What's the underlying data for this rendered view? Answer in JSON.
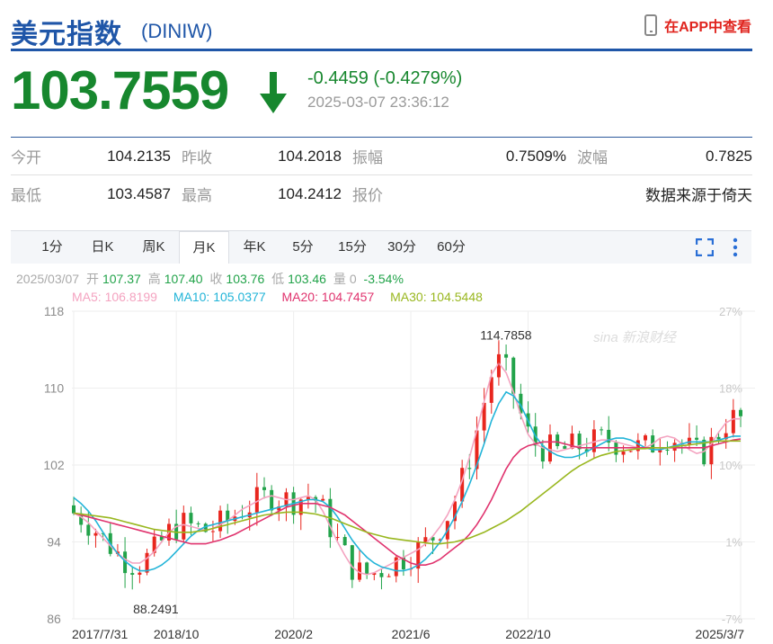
{
  "header": {
    "title": "美元指数",
    "code": "(DINIW)",
    "app_link": "在APP中查看"
  },
  "quote": {
    "price": "103.7559",
    "change": "-0.4459 (-0.4279%)",
    "timestamp": "2025-03-07 23:36:12",
    "down_color": "#17872e"
  },
  "stats": {
    "row1": [
      {
        "label": "今开",
        "value": "104.2135"
      },
      {
        "label": "昨收",
        "value": "104.2018"
      },
      {
        "label": "振幅",
        "value": "0.7509%"
      },
      {
        "label": "波幅",
        "value": "0.7825"
      }
    ],
    "row2": [
      {
        "label": "最低",
        "value": "103.4587"
      },
      {
        "label": "最高",
        "value": "104.2412"
      },
      {
        "label": "报价",
        "value": "数据来源于倚天"
      }
    ]
  },
  "tabs": [
    "1分",
    "日K",
    "周K",
    "月K",
    "年K",
    "5分",
    "15分",
    "30分",
    "60分"
  ],
  "active_tab": "月K",
  "ohlc_line": {
    "date": "2025/03/07",
    "open_label": "开",
    "open": "107.37",
    "high_label": "高",
    "high": "107.40",
    "close_label": "收",
    "close": "103.76",
    "low_label": "低",
    "low": "103.46",
    "vol_label": "量",
    "vol": "0",
    "pct": "-3.54%"
  },
  "ma_legend": [
    {
      "label": "MA5: 106.8199",
      "color": "#f4a3c0"
    },
    {
      "label": "MA10: 105.0377",
      "color": "#22b4d8"
    },
    {
      "label": "MA20: 104.7457",
      "color": "#e0336e"
    },
    {
      "label": "MA30: 104.5448",
      "color": "#99b71f"
    }
  ],
  "chart_data": {
    "type": "candlestick",
    "y_ticks": [
      "118",
      "110",
      "102",
      "94",
      "86"
    ],
    "y_tick_values": [
      118,
      110,
      102,
      94,
      86
    ],
    "ylim": [
      86,
      118
    ],
    "pct_ticks": [
      "27%",
      "18%",
      "10%",
      "1%",
      "-7%"
    ],
    "x_ticks": [
      "2017/7/31",
      "2018/10",
      "2020/2",
      "2021/6",
      "2022/10",
      "2025/3/7"
    ],
    "x_tick_months": [
      0,
      14,
      30,
      46,
      62,
      91
    ],
    "annotations": {
      "max": "114.7858",
      "min": "88.2491"
    },
    "watermark": "sina 新浪财经",
    "series": [
      {
        "name": "MA5",
        "color": "#f4a3c0",
        "values": [
          97,
          96.6,
          96,
          95.2,
          94.4,
          93.6,
          92.8,
          92.2,
          91.8,
          91.8,
          92.3,
          93.0,
          94.0,
          95.0,
          95.6,
          95.8,
          95.6,
          95.4,
          95.2,
          95.4,
          95.8,
          96.2,
          96.8,
          97.4,
          97.8,
          98.2,
          98.6,
          98.8,
          98.6,
          98.4,
          98.4,
          98.6,
          98.8,
          98.4,
          97.2,
          95.6,
          94.0,
          92.6,
          91.4,
          90.8,
          90.6,
          90.8,
          91.2,
          91.6,
          92.0,
          92.4,
          92.8,
          93.2,
          93.8,
          94.6,
          95.6,
          96.8,
          98.4,
          100.4,
          102.8,
          105.6,
          108.6,
          111.4,
          112.6,
          111.6,
          109.6,
          107.2,
          105.2,
          104.2,
          103.8,
          103.6,
          103.4,
          103.6,
          103.8,
          104.0,
          104.2,
          104.4,
          104.6,
          104.6,
          104.4,
          104.2,
          104.0,
          103.8,
          103.8,
          104.2,
          104.8,
          105.0,
          104.8,
          104.2,
          103.6,
          103.2,
          103.4,
          104.2,
          105.4,
          106.4,
          106.8,
          106.8
        ]
      },
      {
        "name": "MA10",
        "color": "#22b4d8",
        "values": [
          98.6,
          98.0,
          97.2,
          96.2,
          95.0,
          93.8,
          92.8,
          92.0,
          91.4,
          91.0,
          91.0,
          91.2,
          91.6,
          92.2,
          93.0,
          93.8,
          94.6,
          95.2,
          95.6,
          95.8,
          96.0,
          96.2,
          96.4,
          96.6,
          96.8,
          97.0,
          97.2,
          97.4,
          97.6,
          97.8,
          98.0,
          98.2,
          98.4,
          98.4,
          98.2,
          97.6,
          96.6,
          95.4,
          94.2,
          93.2,
          92.4,
          91.8,
          91.4,
          91.2,
          91.0,
          91.0,
          91.2,
          91.6,
          92.2,
          93.0,
          94.0,
          95.2,
          96.6,
          98.2,
          100.0,
          102.0,
          104.2,
          106.6,
          108.4,
          109.6,
          109.2,
          108.2,
          106.6,
          105.0,
          104.0,
          103.4,
          103.0,
          102.8,
          102.8,
          103.0,
          103.4,
          103.8,
          104.2,
          104.6,
          104.8,
          104.8,
          104.6,
          104.2,
          103.8,
          103.6,
          103.6,
          103.8,
          104.0,
          104.2,
          104.4,
          104.4,
          104.4,
          104.4,
          104.6,
          104.8,
          105.0,
          105.0
        ]
      },
      {
        "name": "MA20",
        "color": "#e0336e",
        "values": [
          97.0,
          96.8,
          96.6,
          96.4,
          96.2,
          96.0,
          95.8,
          95.6,
          95.4,
          95.2,
          95.0,
          94.8,
          94.6,
          94.4,
          94.2,
          94.0,
          93.8,
          93.8,
          93.8,
          94.0,
          94.2,
          94.5,
          94.8,
          95.2,
          95.6,
          96.0,
          96.4,
          96.8,
          97.2,
          97.6,
          97.8,
          98.0,
          98.0,
          98.0,
          97.8,
          97.6,
          97.2,
          96.8,
          96.2,
          95.6,
          95.0,
          94.4,
          93.8,
          93.2,
          92.6,
          92.2,
          91.8,
          91.6,
          91.6,
          91.8,
          92.2,
          92.8,
          93.4,
          94.0,
          94.8,
          95.8,
          97.0,
          98.4,
          100.0,
          101.6,
          102.8,
          103.6,
          104.0,
          104.2,
          104.4,
          104.4,
          104.4,
          104.2,
          104.0,
          103.8,
          103.8,
          103.8,
          103.8,
          103.8,
          103.8,
          103.8,
          103.8,
          103.8,
          103.8,
          103.8,
          103.8,
          103.8,
          103.8,
          103.8,
          103.8,
          103.8,
          103.8,
          104.0,
          104.2,
          104.4,
          104.6,
          104.7
        ]
      },
      {
        "name": "MA30",
        "color": "#99b71f",
        "values": [
          97.0,
          96.9,
          96.8,
          96.7,
          96.6,
          96.5,
          96.3,
          96.1,
          95.9,
          95.7,
          95.5,
          95.3,
          95.2,
          95.1,
          95.0,
          95.0,
          95.0,
          95.1,
          95.2,
          95.4,
          95.6,
          95.8,
          96.0,
          96.2,
          96.4,
          96.6,
          96.8,
          96.9,
          97.0,
          97.1,
          97.1,
          97.1,
          97.0,
          96.9,
          96.7,
          96.5,
          96.2,
          95.9,
          95.6,
          95.3,
          95.0,
          94.8,
          94.6,
          94.4,
          94.3,
          94.2,
          94.1,
          94.0,
          93.9,
          93.8,
          93.8,
          93.9,
          94.0,
          94.2,
          94.4,
          94.7,
          95.0,
          95.4,
          95.8,
          96.2,
          96.7,
          97.2,
          97.8,
          98.4,
          99.0,
          99.6,
          100.2,
          100.8,
          101.4,
          101.9,
          102.3,
          102.7,
          103.0,
          103.2,
          103.4,
          103.5,
          103.6,
          103.7,
          103.7,
          103.8,
          103.8,
          103.8,
          103.9,
          104.0,
          104.1,
          104.2,
          104.3,
          104.4,
          104.5,
          104.5,
          104.5,
          104.5
        ]
      }
    ]
  }
}
